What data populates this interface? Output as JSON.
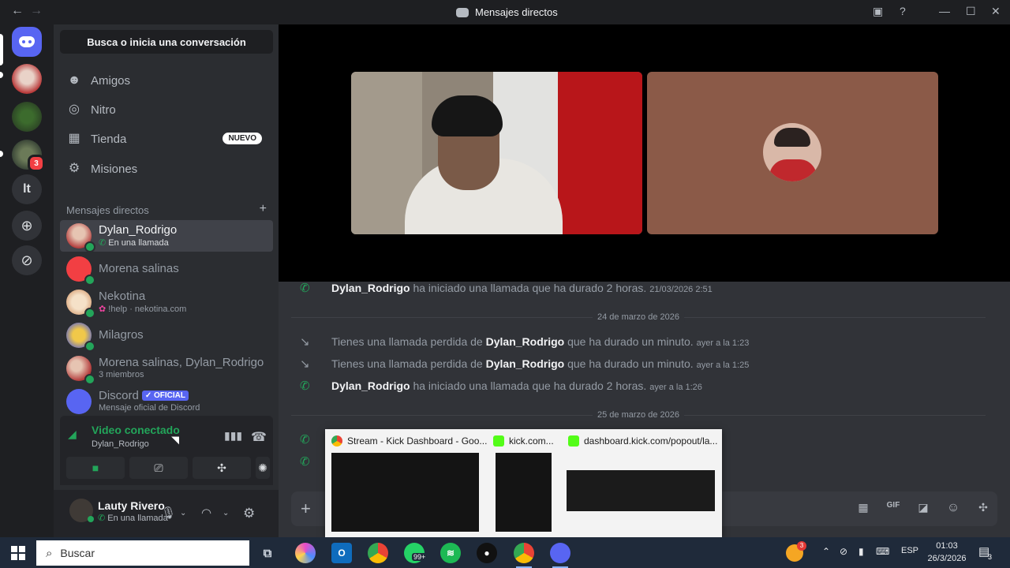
{
  "window": {
    "title": "Mensajes directos"
  },
  "servers": {
    "badge": "3",
    "text_server": "lt"
  },
  "sidebar": {
    "search_label": "Busca o inicia una conversación",
    "nav": [
      {
        "label": "Amigos",
        "icon": "friends-icon"
      },
      {
        "label": "Nitro",
        "icon": "nitro-icon"
      },
      {
        "label": "Tienda",
        "icon": "shop-icon",
        "badge": "NUEVO"
      },
      {
        "label": "Misiones",
        "icon": "quests-icon"
      }
    ],
    "dm_header": "Mensajes directos",
    "dms": [
      {
        "name": "Dylan_Rodrigo",
        "sub": "En una llamada",
        "active": true
      },
      {
        "name": "Morena salinas",
        "sub": ""
      },
      {
        "name": "Nekotina",
        "sub": "!help · nekotina.com"
      },
      {
        "name": "Milagros",
        "sub": ""
      },
      {
        "name": "Morena salinas, Dylan_Rodrigo",
        "sub": "3 miembros"
      },
      {
        "name": "Discord",
        "sub": "Mensaje oficial de Discord",
        "tag": "✓ OFICIAL"
      }
    ]
  },
  "voice": {
    "title": "Video conectado",
    "sub": "Dylan_Rodrigo"
  },
  "user": {
    "name": "Lauty Rivero",
    "status": "En una llamada"
  },
  "messages": [
    {
      "kind": "call",
      "user": "Dylan_Rodrigo",
      "text": " ha iniciado una llamada que ha durado 2 horas.",
      "time": "21/03/2026 2:51"
    },
    {
      "kind": "date",
      "text": "24 de marzo de 2026"
    },
    {
      "kind": "missed",
      "prefix": "Tienes una llamada perdida de ",
      "user": "Dylan_Rodrigo",
      "text": " que ha durado un minuto.",
      "time": "ayer a la 1:23"
    },
    {
      "kind": "missed",
      "prefix": "Tienes una llamada perdida de ",
      "user": "Dylan_Rodrigo",
      "text": " que ha durado un minuto.",
      "time": "ayer a la 1:25"
    },
    {
      "kind": "call",
      "user": "Dylan_Rodrigo",
      "text": " ha iniciado una llamada que ha durado 2 horas.",
      "time": "ayer a la 1:26"
    },
    {
      "kind": "date",
      "text": "25 de marzo de 2026"
    }
  ],
  "taskbar_preview": [
    {
      "title": "Stream - Kick Dashboard - Goo...",
      "icon": "chrome-icon"
    },
    {
      "title": "kick.com...",
      "icon": "kick-icon"
    },
    {
      "title": "dashboard.kick.com/popout/la...",
      "icon": "kick-icon"
    }
  ],
  "taskbar": {
    "search_placeholder": "Buscar",
    "whatsapp_badge": "99+",
    "lang": "ESP",
    "time": "01:03",
    "date": "26/3/2026",
    "notif_count": "3",
    "tray_badge": "3"
  },
  "colors": {
    "accent": "#5865f2",
    "green": "#23a55a",
    "red": "#f23f43"
  }
}
